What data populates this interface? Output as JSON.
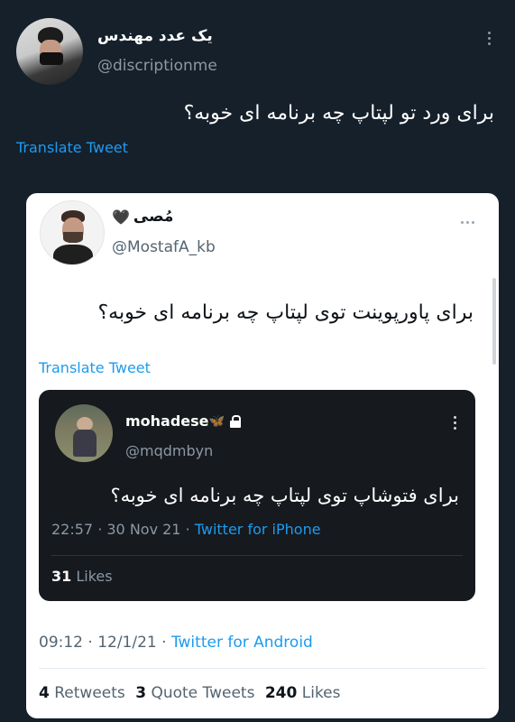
{
  "outer": {
    "name": "یک عدد مهندس",
    "handle": "@discriptionme",
    "text": "برای ورد تو لپتاپ چه برنامه ای خوبه؟",
    "translate": "Translate Tweet"
  },
  "card": {
    "name": "مُصی",
    "name_emoji": "🖤",
    "handle": "@MostafA_kb",
    "text": "برای پاورپوینت توی لپتاپ چه برنامه ای خوبه؟",
    "translate": "Translate Tweet",
    "time": "09:12 · 12/1/21 · ",
    "source": "Twitter for Android",
    "retweets_count": "4",
    "retweets_label": "Retweets",
    "quotes_count": "3",
    "quotes_label": "Quote Tweets",
    "likes_count": "240",
    "likes_label": "Likes"
  },
  "quoted": {
    "name": "mohadese",
    "butterfly": "🦋",
    "handle": "@mqdmbyn",
    "text": "برای فتوشاپ توی لپتاپ چه برنامه ای خوبه؟",
    "time": "22:57 · 30 Nov 21 · ",
    "source": "Twitter for iPhone",
    "likes_count": "31",
    "likes_label": "Likes"
  },
  "colors": {
    "dark_bg": "#15202b",
    "link": "#1d9bf0",
    "card_bg": "#ffffff",
    "quoted_bg": "#16191d"
  }
}
